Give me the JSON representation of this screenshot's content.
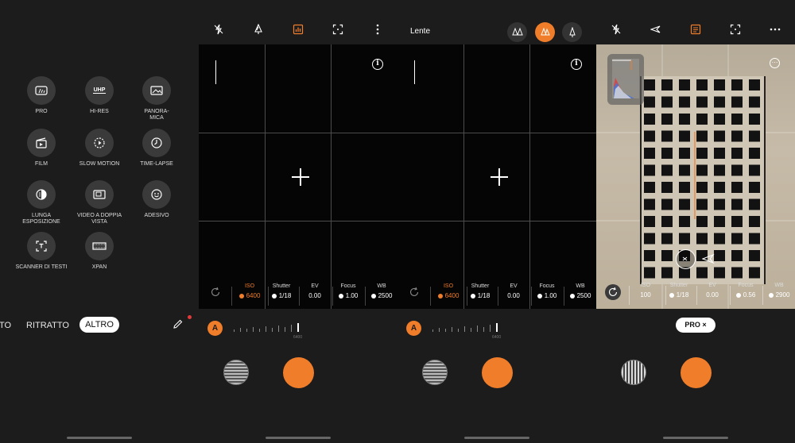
{
  "panel1": {
    "modes": [
      {
        "label": "PRO",
        "icon": "pro-icon"
      },
      {
        "label": "HI-RES",
        "icon": "uhp-icon",
        "icon_text": "UHP"
      },
      {
        "label": "PANORA-MICA",
        "icon": "panorama-icon"
      },
      {
        "label": "FILM",
        "icon": "film-icon"
      },
      {
        "label": "SLOW MOTION",
        "icon": "slow-motion-icon"
      },
      {
        "label": "TIME-LAPSE",
        "icon": "time-lapse-icon"
      },
      {
        "label": "LUNGA ESPOSIZIONE",
        "icon": "long-exposure-icon"
      },
      {
        "label": "VIDEO A DOPPIA VISTA",
        "icon": "dual-view-icon"
      },
      {
        "label": "ADESIVO",
        "icon": "sticker-icon"
      },
      {
        "label": "SCANNER DI TESTI",
        "icon": "text-scanner-icon"
      },
      {
        "label": "XPAN",
        "icon": "xpan-icon"
      }
    ],
    "tabs": {
      "partial": "TO",
      "portrait": "RITRATTO",
      "more": "ALTRO"
    }
  },
  "panel2": {
    "params": [
      {
        "label": "ISO",
        "value": "6400",
        "selected": true
      },
      {
        "label": "Shutter",
        "value": "1/18",
        "selected": false
      },
      {
        "label": "EV",
        "value": "0.00",
        "selected": false
      },
      {
        "label": "Focus",
        "value": "1.00",
        "selected": false
      },
      {
        "label": "WB",
        "value": "2500",
        "selected": false
      }
    ],
    "auto": "A",
    "slider_value": "6400",
    "info": "i"
  },
  "panel3": {
    "title": "Lente",
    "params": [
      {
        "label": "ISO",
        "value": "6400",
        "selected": true
      },
      {
        "label": "Shutter",
        "value": "1/18",
        "selected": false
      },
      {
        "label": "EV",
        "value": "0.00",
        "selected": false
      },
      {
        "label": "Focus",
        "value": "1.00",
        "selected": false
      },
      {
        "label": "WB",
        "value": "2500",
        "selected": false
      }
    ],
    "auto": "A",
    "slider_value": "6400",
    "info": "i"
  },
  "panel4": {
    "params": [
      {
        "label": "ISO",
        "value": "100"
      },
      {
        "label": "Shutter",
        "value": "1/18"
      },
      {
        "label": "EV",
        "value": "0.00"
      },
      {
        "label": "Focus",
        "value": "0.56"
      },
      {
        "label": "WB",
        "value": "2900"
      }
    ],
    "mode_chip": "PRO",
    "chip_close": "×"
  },
  "colors": {
    "accent": "#f07d2a",
    "background": "#1c1c1c",
    "viewfinder": "#050505"
  }
}
